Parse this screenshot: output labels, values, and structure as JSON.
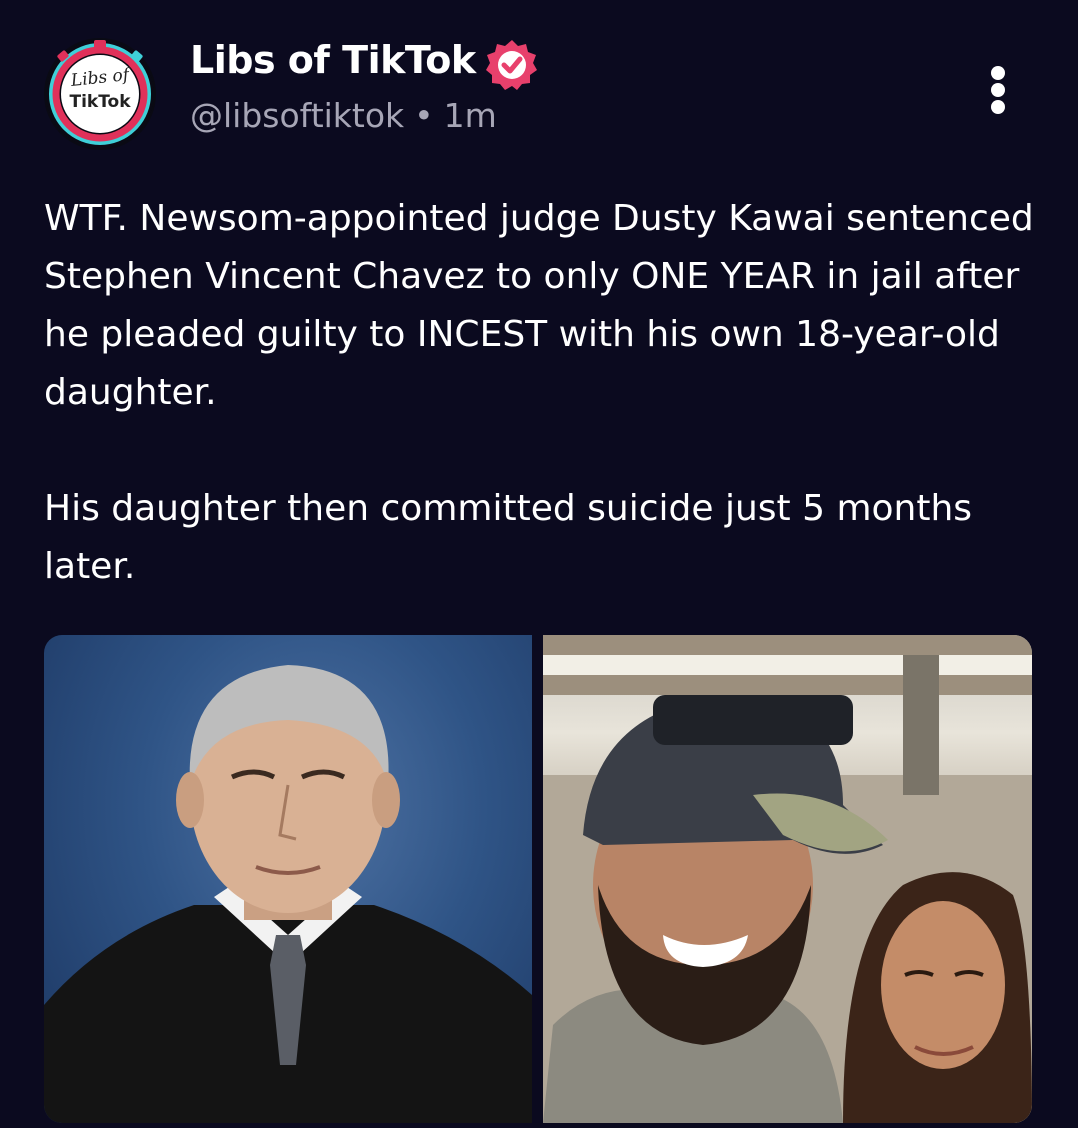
{
  "author": {
    "display_name": "Libs of TikTok",
    "handle": "@libsoftiktok",
    "separator": "•",
    "timestamp": "1m",
    "verified": true,
    "avatar": {
      "line1": "Libs of",
      "line2": "TikTok"
    }
  },
  "post": {
    "paragraphs": [
      "WTF. Newsom-appointed judge Dusty Kawai sentenced Stephen Vincent Chavez to only ONE YEAR in jail after he pleaded guilty to INCEST with his own 18-year-old daughter.",
      "His daughter then committed suicide just 5 months later."
    ]
  },
  "media": {
    "count": 2
  },
  "icons": {
    "verified": "verified-badge-icon",
    "more": "more-options-icon"
  },
  "colors": {
    "background": "#0b0a1f",
    "text_primary": "#ffffff",
    "text_secondary": "#a7a6b6",
    "verified_badge": "#e8406c",
    "avatar_ring_red": "#e0315a",
    "avatar_ring_cyan": "#3fd0d8"
  }
}
